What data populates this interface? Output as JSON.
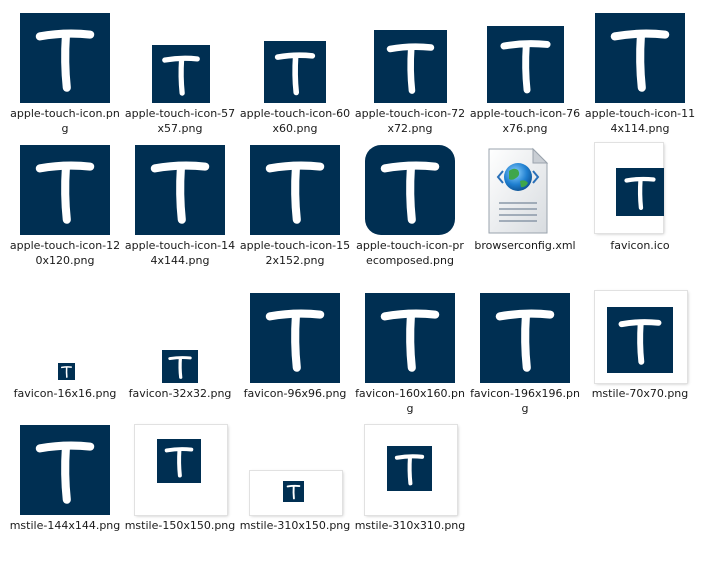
{
  "window": {
    "view": "explorer-large-icons"
  },
  "colors": {
    "icon_navy": "#002f52",
    "icon_glyph": "#ffffff",
    "tile_background": "#ffffff"
  },
  "items": [
    {
      "label": "apple-touch-icon.png",
      "kind": "navy",
      "icon": "t-logo-icon"
    },
    {
      "label": "apple-touch-icon-57x57.png",
      "kind": "navy",
      "icon": "t-logo-icon"
    },
    {
      "label": "apple-touch-icon-60x60.png",
      "kind": "navy",
      "icon": "t-logo-icon"
    },
    {
      "label": "apple-touch-icon-72x72.png",
      "kind": "navy",
      "icon": "t-logo-icon"
    },
    {
      "label": "apple-touch-icon-76x76.png",
      "kind": "navy",
      "icon": "t-logo-icon"
    },
    {
      "label": "apple-touch-icon-114x114.png",
      "kind": "navy",
      "icon": "t-logo-icon"
    },
    {
      "label": "apple-touch-icon-120x120.png",
      "kind": "navy",
      "icon": "t-logo-icon"
    },
    {
      "label": "apple-touch-icon-144x144.png",
      "kind": "navy",
      "icon": "t-logo-icon"
    },
    {
      "label": "apple-touch-icon-152x152.png",
      "kind": "navy",
      "icon": "t-logo-icon"
    },
    {
      "label": "apple-touch-icon-precomposed.png",
      "kind": "navy-rounded",
      "icon": "t-logo-icon"
    },
    {
      "label": "browserconfig.xml",
      "kind": "xml",
      "icon": "xml-document-globe-icon"
    },
    {
      "label": "favicon.ico",
      "kind": "tile",
      "icon": "t-logo-icon"
    },
    {
      "label": "favicon-16x16.png",
      "kind": "navy",
      "icon": "t-logo-icon"
    },
    {
      "label": "favicon-32x32.png",
      "kind": "navy",
      "icon": "t-logo-icon"
    },
    {
      "label": "favicon-96x96.png",
      "kind": "navy",
      "icon": "t-logo-icon"
    },
    {
      "label": "favicon-160x160.png",
      "kind": "navy",
      "icon": "t-logo-icon"
    },
    {
      "label": "favicon-196x196.png",
      "kind": "navy",
      "icon": "t-logo-icon"
    },
    {
      "label": "mstile-70x70.png",
      "kind": "tile",
      "icon": "t-logo-icon"
    },
    {
      "label": "mstile-144x144.png",
      "kind": "navy",
      "icon": "t-logo-icon"
    },
    {
      "label": "mstile-150x150.png",
      "kind": "tile",
      "icon": "t-logo-icon"
    },
    {
      "label": "mstile-310x150.png",
      "kind": "tile",
      "icon": "t-logo-icon"
    },
    {
      "label": "mstile-310x310.png",
      "kind": "tile",
      "icon": "t-logo-icon"
    }
  ]
}
